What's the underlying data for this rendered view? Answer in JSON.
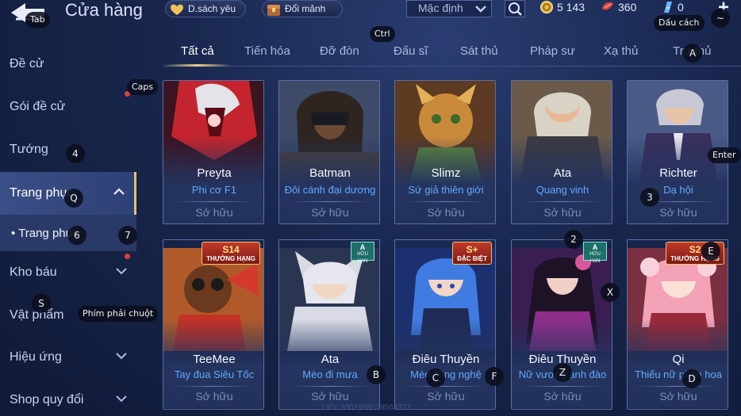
{
  "header": {
    "title": "Cửa hàng",
    "wishlist_label": "D.sách yêu",
    "exchange_label": "Đổi mảnh",
    "sort_value": "Mặc định",
    "currency": {
      "gold": "5 143",
      "gems": "360",
      "vouchers": "0"
    }
  },
  "key_hints": {
    "tab": "Tab",
    "ctrl": "Ctrl",
    "space": "Dấu cách",
    "tilde": "~",
    "a": "A",
    "caps": "Caps",
    "enter": "Enter",
    "n4": "4",
    "q": "Q",
    "n6": "6",
    "n7": "7",
    "n3": "3",
    "n2": "2",
    "e": "E",
    "x": "X",
    "s": "S",
    "rmb": "Phím phải chuột",
    "b": "B",
    "c": "C",
    "f": "F",
    "z": "Z",
    "d": "D"
  },
  "sidebar": {
    "items": [
      {
        "label": "Đề cử"
      },
      {
        "label": "Gói đề cử"
      },
      {
        "label": "Tướng"
      },
      {
        "label": "Trang phục"
      },
      {
        "label": "• Trang phục"
      },
      {
        "label": "Kho báu"
      },
      {
        "label": "Vật phẩm"
      },
      {
        "label": "Hiệu ứng"
      },
      {
        "label": "Shop quy đổi"
      }
    ]
  },
  "tabs": [
    "Tất cả",
    "Tiến hóa",
    "Đỡ đòn",
    "Đấu sĩ",
    "Sát thủ",
    "Pháp sư",
    "Xạ thủ",
    "Trợ thủ"
  ],
  "cards": [
    {
      "hero": "Preyta",
      "skin": "Phi cơ F1",
      "status": "Sở hữu"
    },
    {
      "hero": "Batman",
      "skin": "Đôi cánh đại dương",
      "status": "Sở hữu"
    },
    {
      "hero": "Slimz",
      "skin": "Sứ giả thiên giới",
      "status": "Sở hữu"
    },
    {
      "hero": "Ata",
      "skin": "Quang vinh",
      "status": "Sở hữu"
    },
    {
      "hero": "Richter",
      "skin": "Dạ hội",
      "status": "Sở hữu"
    },
    {
      "hero": "TeeMee",
      "skin": "Tay đua Siêu Tốc",
      "status": "Sở hữu",
      "tag_big": "S14",
      "tag": "THƯỞNG HẠNG"
    },
    {
      "hero": "Ata",
      "skin": "Mèo đi mưa",
      "status": "Sở hữu",
      "tag_big": "A",
      "tag": "HỮU HẠN"
    },
    {
      "hero": "Điêu Thuyền",
      "skin": "Mèo công nghệ",
      "status": "Sở hữu",
      "tag_big": "S+",
      "tag": "ĐẶC BIỆT"
    },
    {
      "hero": "Điêu Thuyền",
      "skin": "Nữ vương anh đào",
      "status": "Sở hữu",
      "tag_big": "A",
      "tag": "HỮU HẠN"
    },
    {
      "hero": "Qi",
      "skin": "Thiếu nữ pháo hoa",
      "status": "Sở hữu",
      "tag_big": "S2",
      "tag": "THƯỞNG HẠNG"
    }
  ],
  "footer": {
    "uid": "UID: 3002998519563377"
  },
  "colors": {
    "accent_gold": "#e7c06a",
    "skin_blue": "#63a8ff",
    "panel": "#22325b"
  },
  "icons": [
    "back-arrow-icon",
    "heart-icon",
    "chest-icon",
    "chevron-down-icon",
    "search-icon",
    "gold-coin-icon",
    "gem-icon",
    "voucher-icon",
    "plus-icon"
  ]
}
